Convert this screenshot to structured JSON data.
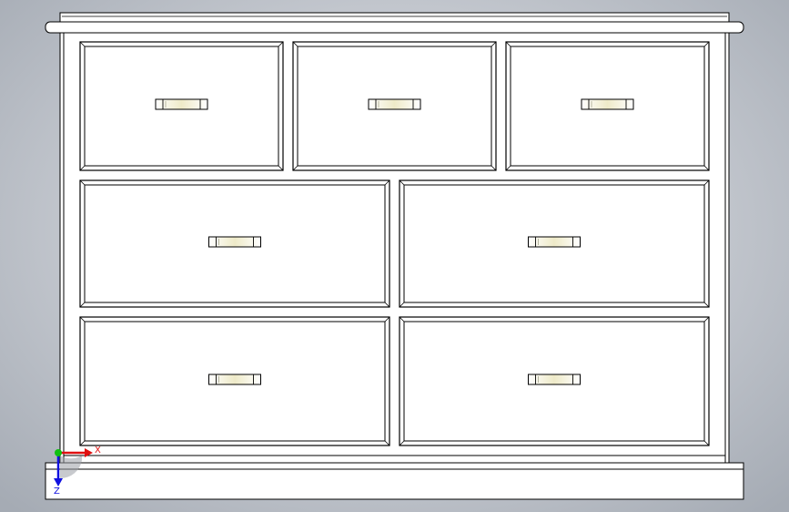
{
  "model": {
    "part": "chest-of-drawers",
    "view": "front",
    "drawer_rows": [
      3,
      2,
      2
    ],
    "colors": {
      "background": "#c4c8cf",
      "body_fill": "#ffffff",
      "edge_line": "#000000",
      "x_axis": "#e01010",
      "y_axis": "#10c010",
      "z_axis": "#1010e0"
    }
  },
  "triad": {
    "x_label": "X",
    "z_label": "Z"
  }
}
